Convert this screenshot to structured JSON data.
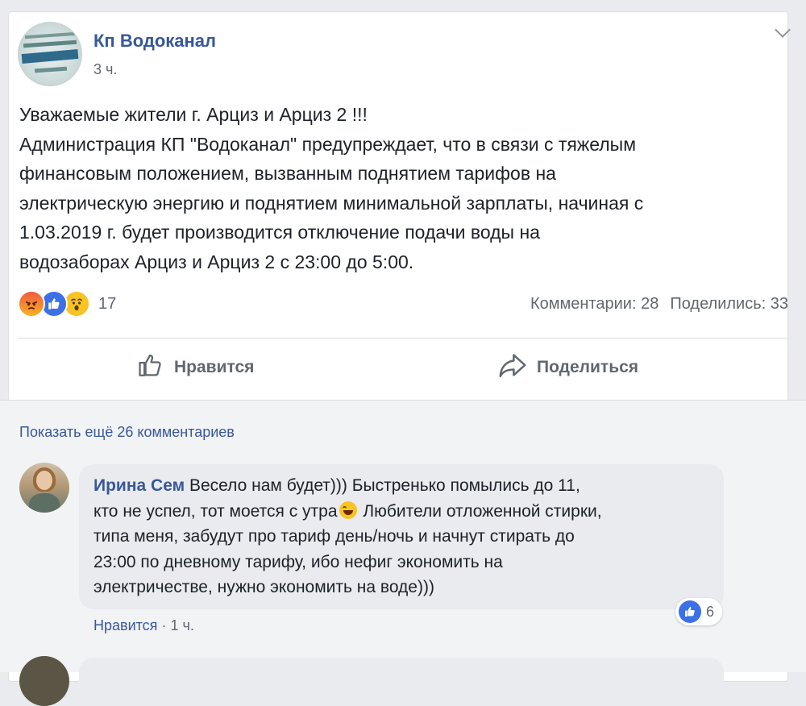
{
  "post": {
    "page_name": "Кп Водоканал",
    "time": "3 ч.",
    "text_lines": [
      "Уважаемые жители г. Арциз и Арциз 2 !!!",
      "Администрация КП \"Водоканал\" предупреждает, что в связи с тяжелым",
      "финансовым положением, вызванным поднятием тарифов на",
      "электрическую энергию и поднятием минимальной зарплаты, начиная с",
      "1.03.2019 г. будет производится отключение подачи воды на",
      "водозаборах Арциз и Арциз 2 с 23:00 до 5:00."
    ],
    "reactions": {
      "icons": [
        "angry-icon",
        "like-icon",
        "wow-icon"
      ],
      "count": "17"
    },
    "comments_count": "Комментарии: 28",
    "shares_count": "Поделились: 33",
    "like_label": "Нравится",
    "share_label": "Поделиться"
  },
  "comments": {
    "show_more": "Показать ещё 26 комментариев",
    "items": [
      {
        "author": "Ирина Сем",
        "line1": "Весело нам будет))) Быстренько помылись до 11,",
        "line2_before": "кто не успел, тот моется с утра",
        "line2_after": " Любители отложенной стирки,",
        "line3": "типа меня, забудут про тариф день/ночь и начнут стирать до",
        "line4": "23:00 по дневному тарифу, ибо нефиг экономить на",
        "line5": "электричестве, нужно экономить на воде)))",
        "like_label": "Нравится",
        "separator": "·",
        "time": "1 ч.",
        "reaction_count": "6"
      }
    ]
  },
  "colors": {
    "link": "#385898",
    "page_name": "#365899",
    "like_blue": "#3b70e6",
    "secondary_text": "#616770"
  }
}
